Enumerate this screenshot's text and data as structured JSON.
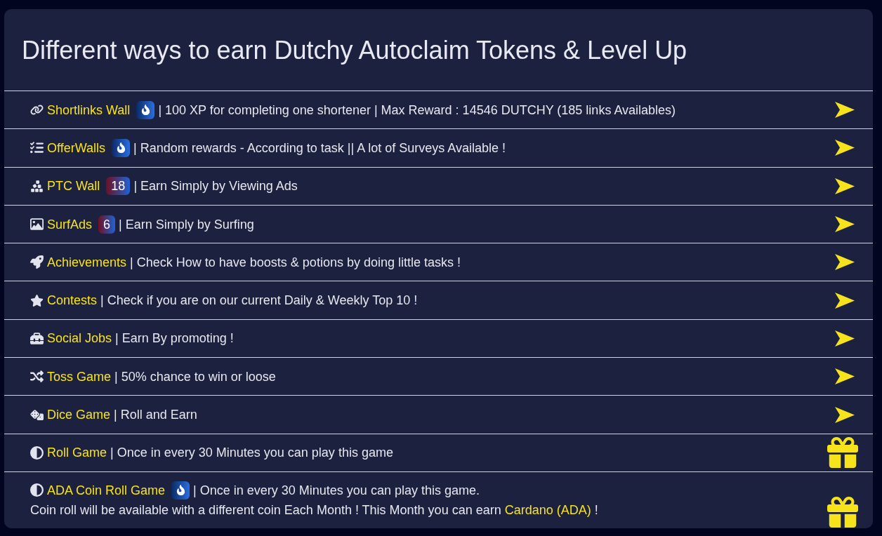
{
  "heading": "Different ways to earn Dutchy Autoclaim Tokens & Level Up",
  "rows": [
    {
      "kind": "send",
      "link": "Shortlinks Wall",
      "badge": {
        "kind": "fire"
      },
      "description": "| 100 XP for completing one shortener | Max Reward : 14546 DUTCHY (185 links Availables)"
    },
    {
      "kind": "send",
      "link": "OfferWalls",
      "badge": {
        "kind": "fire"
      },
      "description": "| Random rewards - According to task || A lot of Surveys Available !"
    },
    {
      "kind": "send",
      "link": "PTC Wall",
      "badge": {
        "kind": "count",
        "text": "18"
      },
      "description": "| Earn Simply by Viewing Ads"
    },
    {
      "kind": "send",
      "link": "SurfAds",
      "badge": {
        "kind": "count",
        "text": "6"
      },
      "description": "| Earn Simply by Surfing"
    },
    {
      "kind": "send",
      "link": "Achievements",
      "description": "| Check How to have boosts & potions by doing little tasks !"
    },
    {
      "kind": "send",
      "link": "Contests",
      "description": "| Check if you are on our current Daily & Weekly Top 10 !"
    },
    {
      "kind": "send",
      "link": "Social Jobs",
      "description": "| Earn By promoting !"
    },
    {
      "kind": "send",
      "link": "Toss Game",
      "description": "| 50% chance to win or loose"
    },
    {
      "kind": "send",
      "link": "Dice Game",
      "description": "| Roll and Earn"
    },
    {
      "kind": "gift",
      "link": "Roll Game",
      "description": "| Once in every 30 Minutes you can play this game"
    },
    {
      "kind": "gift",
      "link": "ADA Coin Roll Game",
      "badge": {
        "kind": "fire"
      },
      "description": "| Once in every 30 Minutes you can play this game.",
      "note": {
        "before": "Coin roll will be available with a different coin Each Month ! This Month you can earn",
        "link": "Cardano (ADA)",
        "after": "!"
      }
    }
  ]
}
